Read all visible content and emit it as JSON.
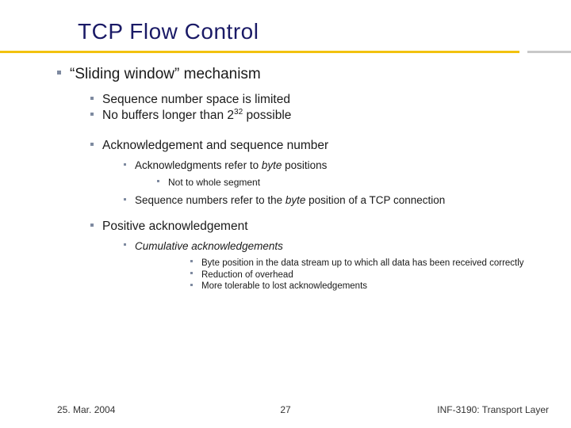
{
  "title": "TCP Flow Control",
  "lvl1": {
    "text": "“Sliding window” mechanism"
  },
  "lvl2": {
    "a": "Sequence number space is limited",
    "b_pre": "No buffers longer than 2",
    "b_sup": "32",
    "b_post": " possible",
    "c": "Acknowledgement and sequence number",
    "d": "Positive acknowledgement"
  },
  "lvl3": {
    "a_pre": "Acknowledgments refer to ",
    "a_it": "byte",
    "a_post": " positions",
    "b_pre": "Sequence numbers refer to the ",
    "b_it": "byte",
    "b_post": " position of a TCP connection",
    "c_it": "Cumulative acknowledgements"
  },
  "lvl4": {
    "a": "Not to whole segment",
    "b": "Byte position in the data stream up to which all data has been received correctly",
    "c": "Reduction of overhead",
    "d": "More tolerable to lost acknowledgements"
  },
  "footer": {
    "date": "25. Mar. 2004",
    "page": "27",
    "course": "INF-3190: Transport Layer"
  }
}
